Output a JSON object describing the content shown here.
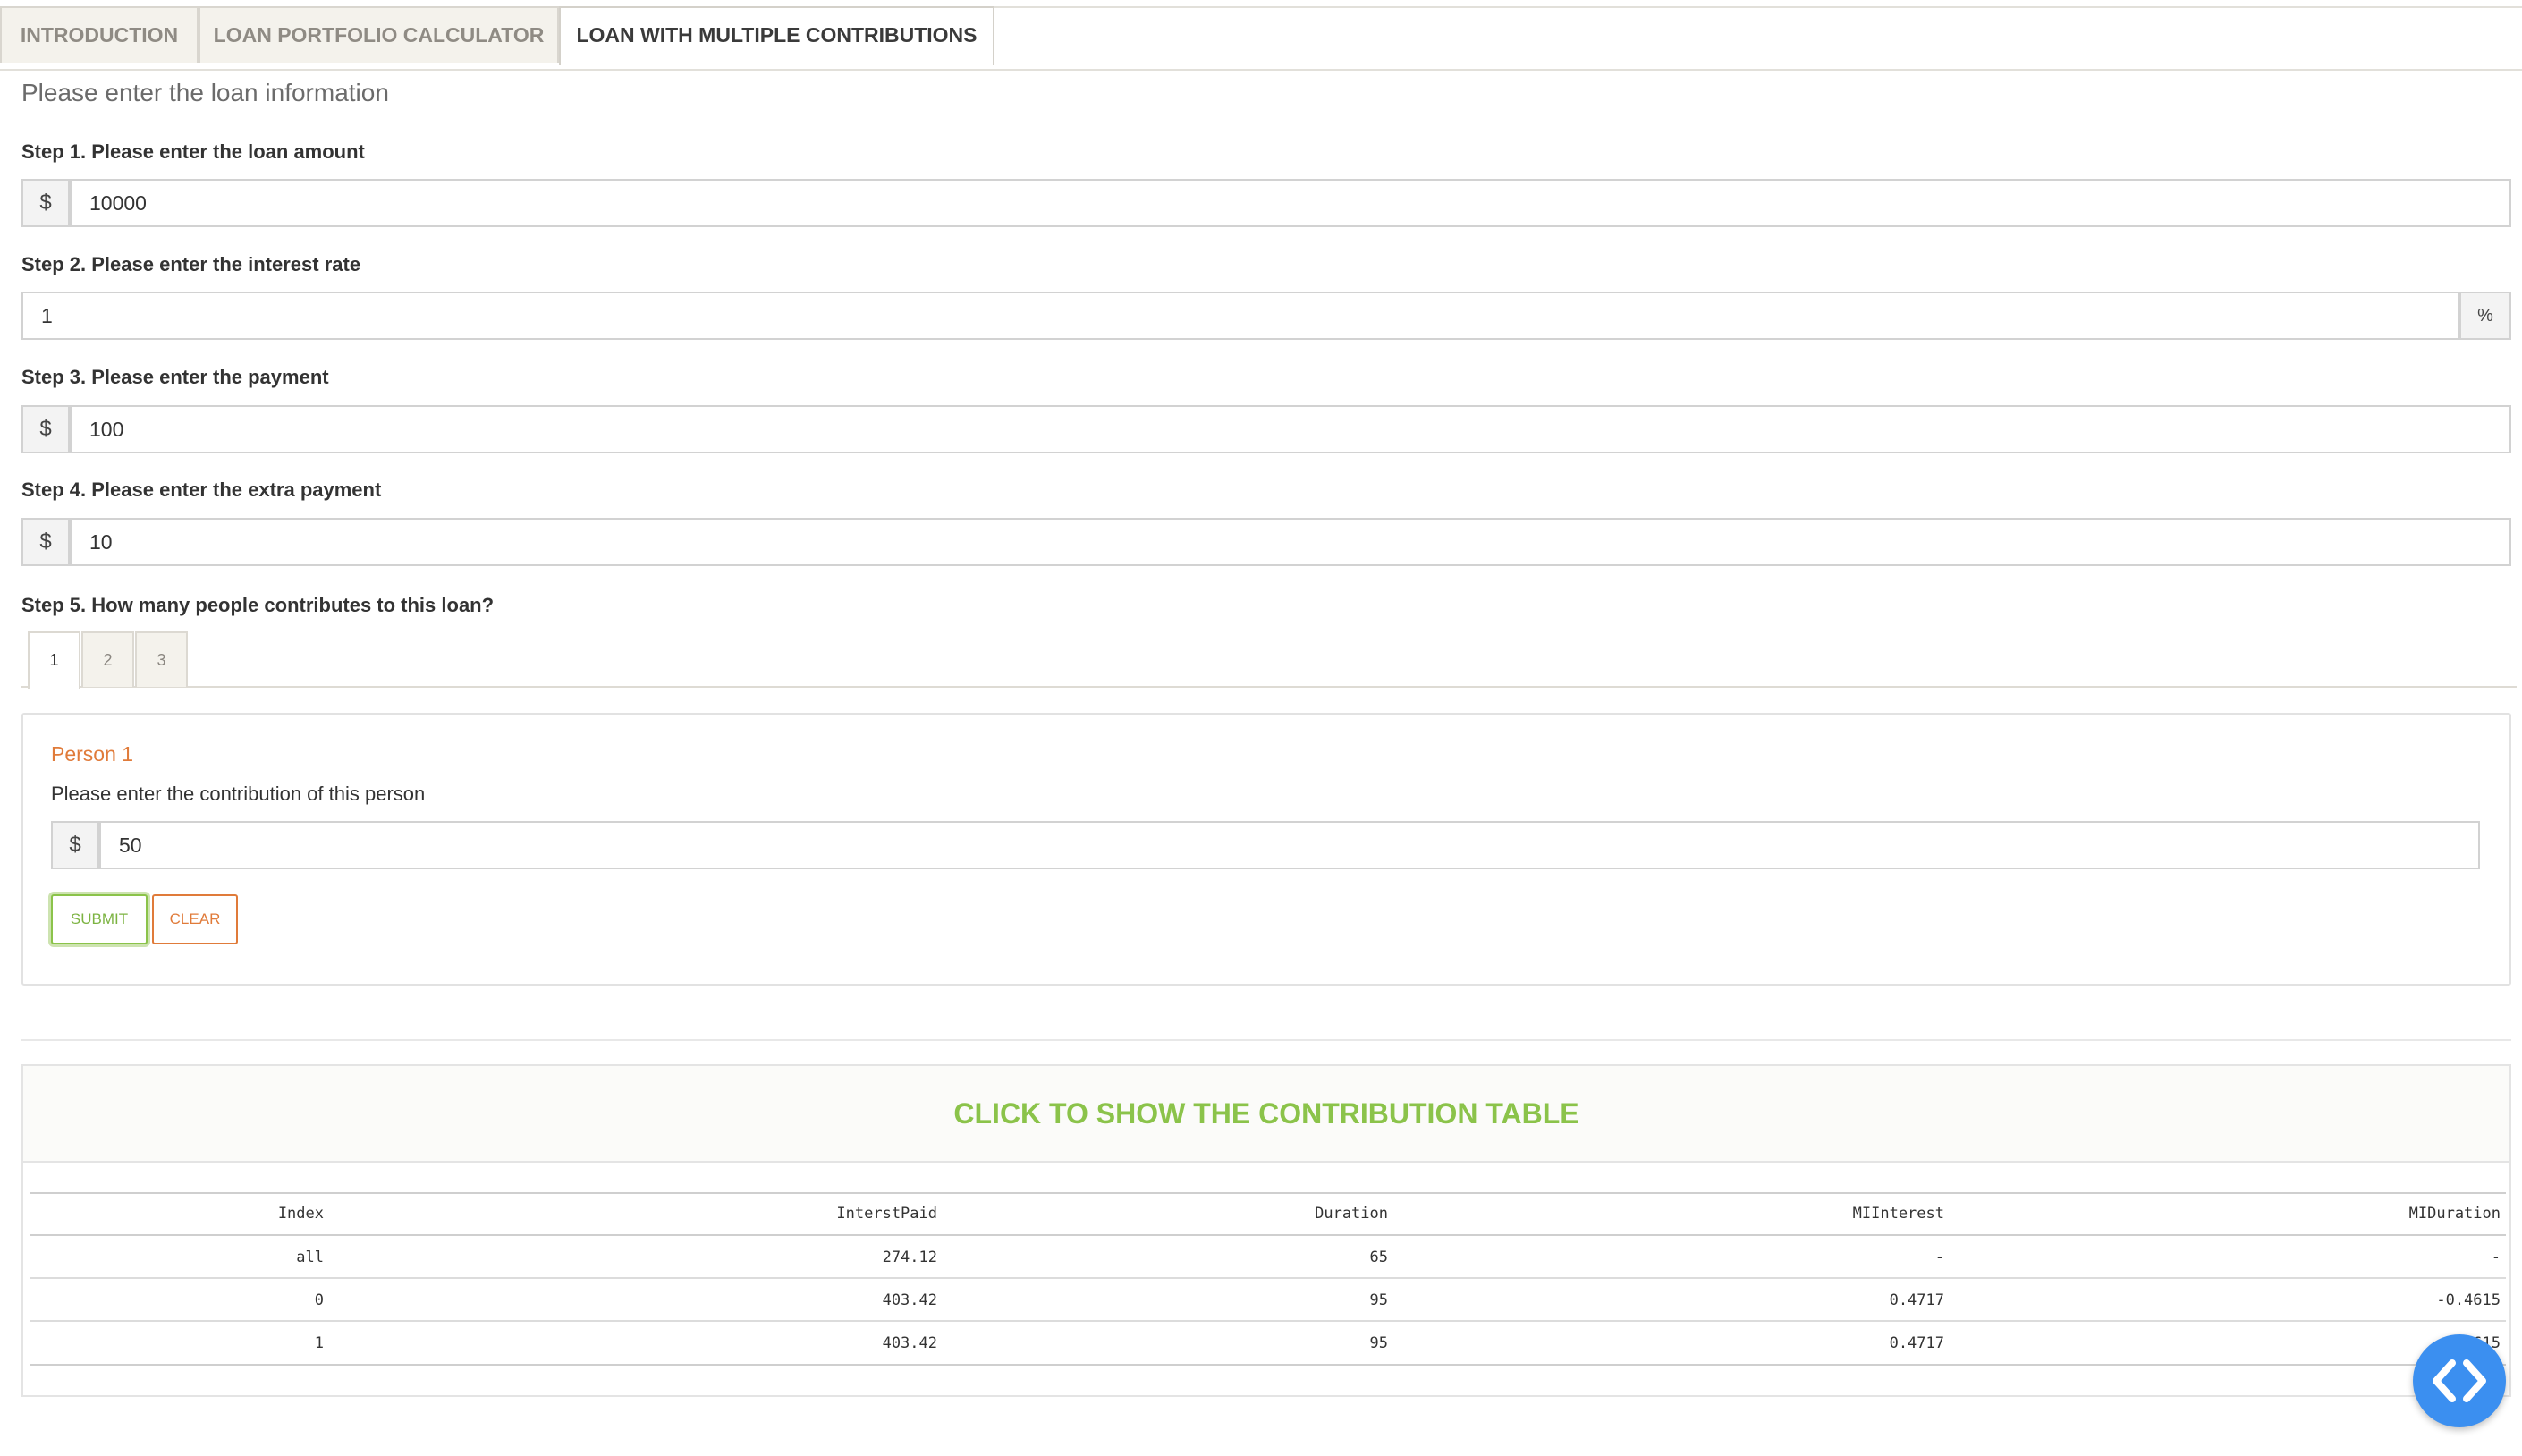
{
  "tabs": {
    "introduction": "INTRODUCTION",
    "loan_portfolio": "LOAN PORTFOLIO CALCULATOR",
    "multiple_contributions": "LOAN WITH MULTIPLE CONTRIBUTIONS"
  },
  "heading": "Please enter the loan information",
  "steps": {
    "step1": {
      "label": "Step 1. Please enter the loan amount",
      "prefix": "$",
      "value": "10000"
    },
    "step2": {
      "label": "Step 2. Please enter the interest rate",
      "suffix": "%",
      "value": "1"
    },
    "step3": {
      "label": "Step 3. Please enter the payment",
      "prefix": "$",
      "value": "100"
    },
    "step4": {
      "label": "Step 4. Please enter the extra payment",
      "prefix": "$",
      "value": "10"
    },
    "step5": {
      "label": "Step 5. How many people contributes to this loan?"
    }
  },
  "people_tabs": [
    "1",
    "2",
    "3"
  ],
  "person_panel": {
    "title": "Person 1",
    "description": "Please enter the contribution of this person",
    "prefix": "$",
    "value": "50",
    "submit": "SUBMIT",
    "clear": "CLEAR"
  },
  "contribution_table": {
    "header": "CLICK TO SHOW THE CONTRIBUTION TABLE",
    "columns": [
      "Index",
      "InterstPaid",
      "Duration",
      "MIInterest",
      "MIDuration"
    ],
    "rows": [
      [
        "all",
        "274.12",
        "65",
        "-",
        "-"
      ],
      [
        "0",
        "403.42",
        "95",
        "0.4717",
        "-0.4615"
      ],
      [
        "1",
        "403.42",
        "95",
        "0.4717",
        "-0.4615"
      ]
    ]
  },
  "colors": {
    "accent_green": "#8bc34a",
    "accent_orange": "#e07b3a",
    "fab_blue": "#3b8ff0"
  },
  "fab": {
    "icon": "code-brackets-icon"
  }
}
